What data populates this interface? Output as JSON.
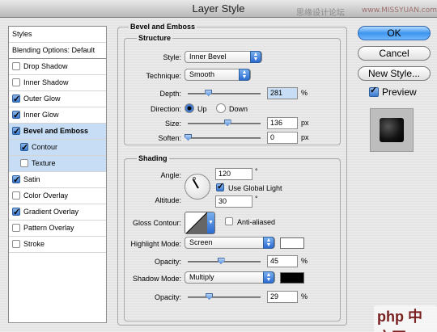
{
  "window": {
    "title": "Layer Style"
  },
  "watermark": {
    "text1": "思缘设计论坛",
    "text2": "www.MISSYUAN.com"
  },
  "styles_list": [
    {
      "label": "Styles",
      "kind": "header"
    },
    {
      "label": "Blending Options: Default",
      "kind": "header"
    },
    {
      "label": "Drop Shadow",
      "checked": false
    },
    {
      "label": "Inner Shadow",
      "checked": false
    },
    {
      "label": "Outer Glow",
      "checked": true
    },
    {
      "label": "Inner Glow",
      "checked": true
    },
    {
      "label": "Bevel and Emboss",
      "checked": true,
      "selected": true
    },
    {
      "label": "Contour",
      "checked": true,
      "sub": true
    },
    {
      "label": "Texture",
      "checked": false,
      "sub": true
    },
    {
      "label": "Satin",
      "checked": true
    },
    {
      "label": "Color Overlay",
      "checked": false
    },
    {
      "label": "Gradient Overlay",
      "checked": true
    },
    {
      "label": "Pattern Overlay",
      "checked": false
    },
    {
      "label": "Stroke",
      "checked": false
    }
  ],
  "bevel": {
    "title": "Bevel and Emboss",
    "structure": {
      "title": "Structure",
      "style_label": "Style:",
      "style_value": "Inner Bevel",
      "technique_label": "Technique:",
      "technique_value": "Smooth",
      "depth_label": "Depth:",
      "depth_value": "281",
      "depth_unit": "%",
      "depth_fraction": 0.28,
      "direction_label": "Direction:",
      "dir_up": "Up",
      "dir_down": "Down",
      "direction_selected": "Up",
      "size_label": "Size:",
      "size_value": "136",
      "size_unit": "px",
      "size_fraction": 0.54,
      "soften_label": "Soften:",
      "soften_value": "0",
      "soften_unit": "px",
      "soften_fraction": 0
    },
    "shading": {
      "title": "Shading",
      "angle_label": "Angle:",
      "angle_value": "120",
      "angle_unit": "°",
      "global_light_label": "Use Global Light",
      "global_light_checked": true,
      "altitude_label": "Altitude:",
      "altitude_value": "30",
      "altitude_unit": "°",
      "gloss_label": "Gloss Contour:",
      "anti_aliased_label": "Anti-aliased",
      "anti_aliased_checked": false,
      "highlight_mode_label": "Highlight Mode:",
      "highlight_mode_value": "Screen",
      "highlight_color": "#ffffff",
      "highlight_opacity_label": "Opacity:",
      "highlight_opacity_value": "45",
      "highlight_opacity_unit": "%",
      "highlight_opacity_fraction": 0.45,
      "shadow_mode_label": "Shadow Mode:",
      "shadow_mode_value": "Multiply",
      "shadow_color": "#000000",
      "shadow_opacity_label": "Opacity:",
      "shadow_opacity_value": "29",
      "shadow_opacity_unit": "%",
      "shadow_opacity_fraction": 0.29
    }
  },
  "buttons": {
    "ok": "OK",
    "cancel": "Cancel",
    "new_style": "New Style...",
    "preview": "Preview",
    "preview_checked": true
  },
  "logo": {
    "text": "php 中文网"
  }
}
